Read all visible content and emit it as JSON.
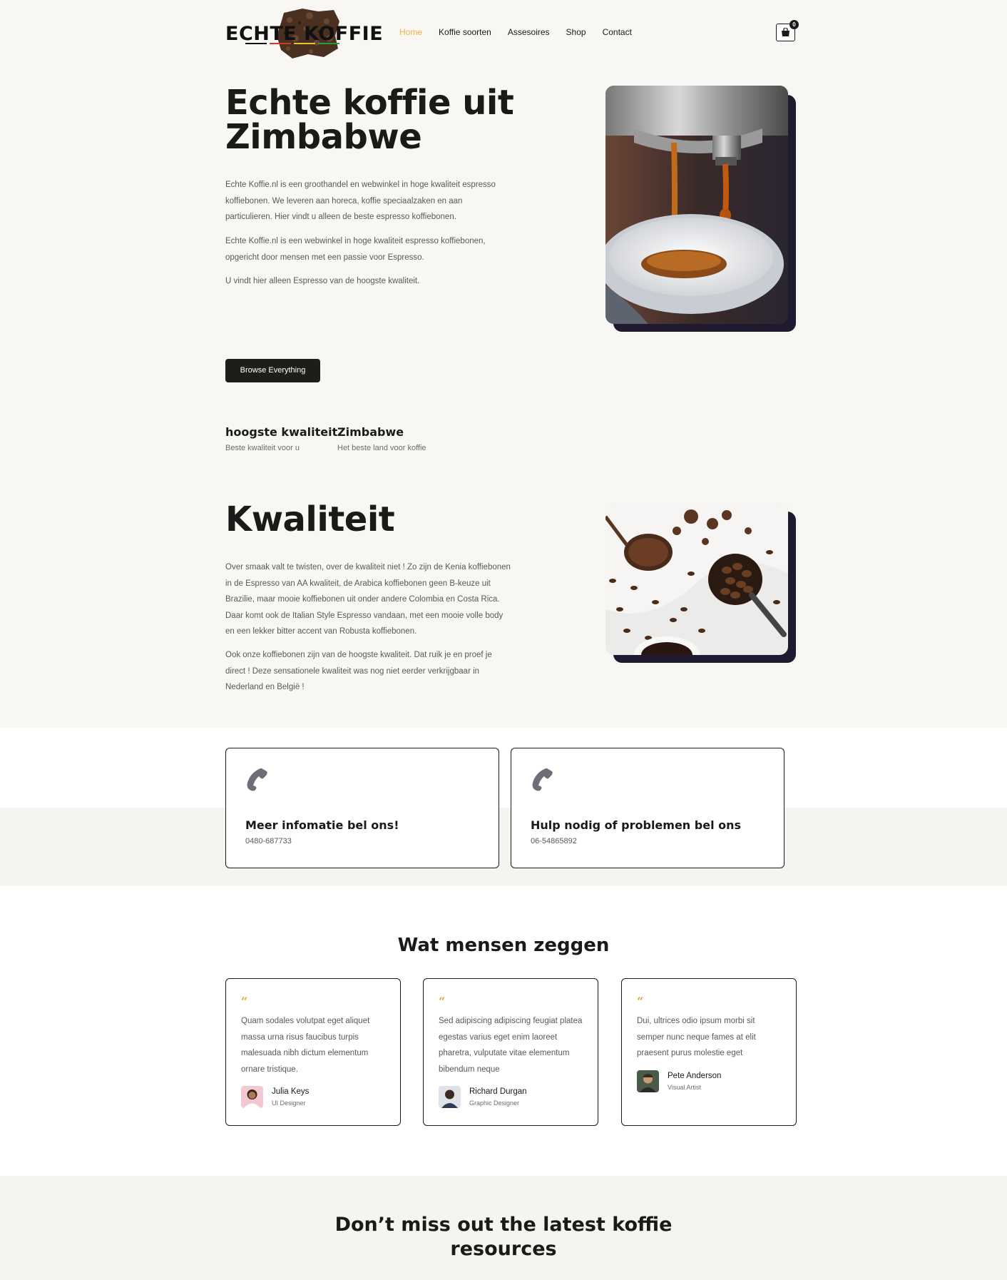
{
  "header": {
    "logo_text": "ECHTE KOFFIE",
    "nav": [
      {
        "label": "Home",
        "active": true
      },
      {
        "label": "Koffie soorten",
        "active": false
      },
      {
        "label": "Assesoires",
        "active": false
      },
      {
        "label": "Shop",
        "active": false
      },
      {
        "label": "Contact",
        "active": false
      }
    ],
    "cart_count": "0"
  },
  "hero": {
    "title_line1": "Echte koffie uit",
    "title_line2": "Zimbabwe",
    "paragraphs": [
      "Echte Koffie.nl is een groothandel en webwinkel in hoge kwaliteit espresso koffiebonen. We leveren aan horeca, koffie speciaalzaken en aan particulieren. Hier vindt u alleen de beste espresso koffiebonen.",
      "Echte Koffie.nl is een webwinkel in hoge kwaliteit espresso koffiebonen, opgericht door mensen met een passie voor Espresso.",
      "U vindt hier alleen Espresso van de hoogste kwaliteit."
    ],
    "button_label": "Browse Everything",
    "stats": [
      {
        "title": "hoogste kwaliteit",
        "subtitle": "Beste kwaliteit voor u"
      },
      {
        "title": "Zimbabwe",
        "subtitle": "Het beste land voor koffie"
      }
    ]
  },
  "quality": {
    "title": "Kwaliteit",
    "paragraphs": [
      "Over smaak valt te twisten, over de kwaliteit niet ! Zo zijn de Kenia koffiebonen in de Espresso van AA kwaliteit, de Arabica koffiebonen geen B-keuze uit Brazilie, maar mooie koffiebonen uit onder andere Colombia en Costa Rica. Daar komt ook de Italian Style Espresso vandaan, met een mooie volle body en een lekker bitter accent van Robusta koffiebonen.",
      "Ook onze koffiebonen zijn van de hoogste kwaliteit. Dat ruik je en proef je direct ! Deze sensationele kwaliteit was nog niet eerder verkrijgbaar in Nederland en België !"
    ]
  },
  "contact": [
    {
      "title": "Meer infomatie bel ons!",
      "phone": "0480-687733"
    },
    {
      "title": "Hulp nodig of problemen bel ons",
      "phone": "06-54865892"
    }
  ],
  "testimonials": {
    "title": "Wat mensen zeggen",
    "items": [
      {
        "quote": "Quam sodales volutpat eget aliquet massa urna risus faucibus turpis malesuada nibh dictum elementum ornare tristique.",
        "name": "Julia Keys",
        "role": "UI Designer"
      },
      {
        "quote": "Sed adipiscing adipiscing feugiat platea egestas varius eget enim laoreet pharetra, vulputate vitae elementum bibendum neque",
        "name": "Richard Durgan",
        "role": "Graphic Designer"
      },
      {
        "quote": "Dui, ultrices odio ipsum morbi sit semper nunc neque fames at elit praesent purus molestie eget",
        "name": "Pete Anderson",
        "role": "Visual Artist"
      }
    ]
  },
  "bottom": {
    "title_line1": "Don’t miss out the latest koffie",
    "title_line2": "resources"
  },
  "colors": {
    "background": "#f8f7f4",
    "accent": "#f0b24a",
    "dark": "#1f1d1a",
    "image_shadow": "#1f1a30"
  }
}
